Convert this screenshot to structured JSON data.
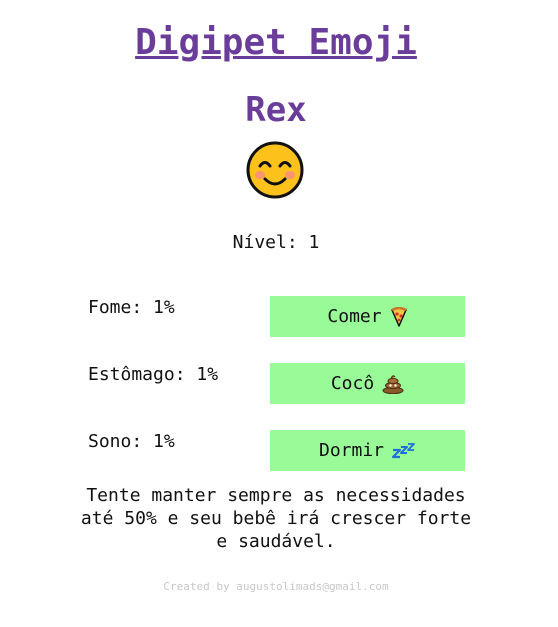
{
  "app": {
    "title": "Digipet Emoji"
  },
  "pet": {
    "name": "Rex",
    "face_icon": "smiling-face-with-smiling-eyes-icon",
    "level_text": "Nível: 1"
  },
  "stats": [
    {
      "label": "Fome: 1%",
      "action_label": "Comer",
      "action_icon": "pizza-icon"
    },
    {
      "label": "Estômago: 1%",
      "action_label": "Cocô",
      "action_icon": "pile-of-poo-icon"
    },
    {
      "label": "Sono: 1%",
      "action_label": "Dormir",
      "action_icon": "zzz-icon"
    }
  ],
  "tip": "Tente manter sempre as necessidades até 50% e seu bebê irá crescer forte e saudável.",
  "footer": "Created by augustolimads@gmail.com",
  "colors": {
    "title": "#6a3d9a",
    "button_bg": "#98fb98",
    "footer_text": "#c8c8c8"
  }
}
